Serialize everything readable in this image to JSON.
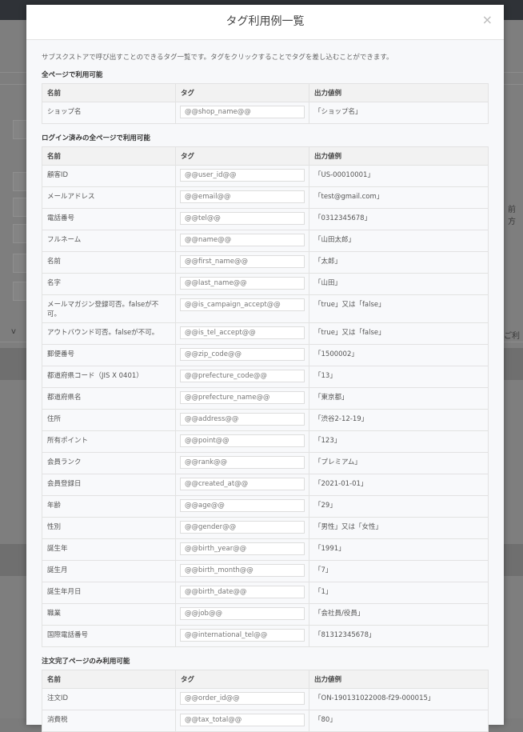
{
  "background": {
    "fragments": [
      "前方",
      "ご利",
      "v"
    ]
  },
  "modal": {
    "title": "タグ利用例一覧",
    "close_label": "×",
    "description": "サブスクストアで呼び出すことのできるタグ一覧です。タグをクリックすることでタグを差し込むことができます。",
    "columns": [
      "名前",
      "タグ",
      "出力値例"
    ],
    "sections": [
      {
        "title": "全ページで利用可能",
        "rows": [
          {
            "name": "ショップ名",
            "tag": "@@shop_name@@",
            "example": "「ショップ名」"
          }
        ]
      },
      {
        "title": "ログイン済みの全ページで利用可能",
        "rows": [
          {
            "name": "顧客ID",
            "tag": "@@user_id@@",
            "example": "「US-00010001」"
          },
          {
            "name": "メールアドレス",
            "tag": "@@email@@",
            "example": "「test@gmail.com」"
          },
          {
            "name": "電話番号",
            "tag": "@@tel@@",
            "example": "「0312345678」"
          },
          {
            "name": "フルネーム",
            "tag": "@@name@@",
            "example": "「山田太郎」"
          },
          {
            "name": "名前",
            "tag": "@@first_name@@",
            "example": "「太郎」"
          },
          {
            "name": "名字",
            "tag": "@@last_name@@",
            "example": "「山田」"
          },
          {
            "name": "メールマガジン登録可否。falseが不可。",
            "tag": "@@is_campaign_accept@@",
            "example": "「true」又は「false」"
          },
          {
            "name": "アウトバウンド可否。falseが不可。",
            "tag": "@@is_tel_accept@@",
            "example": "「true」又は「false」"
          },
          {
            "name": "郵便番号",
            "tag": "@@zip_code@@",
            "example": "「1500002」"
          },
          {
            "name": "都道府県コード（JIS X 0401）",
            "tag": "@@prefecture_code@@",
            "example": "「13」"
          },
          {
            "name": "都道府県名",
            "tag": "@@prefecture_name@@",
            "example": "「東京都」"
          },
          {
            "name": "住所",
            "tag": "@@address@@",
            "example": "「渋谷2-12-19」"
          },
          {
            "name": "所有ポイント",
            "tag": "@@point@@",
            "example": "「123」"
          },
          {
            "name": "会員ランク",
            "tag": "@@rank@@",
            "example": "「プレミアム」"
          },
          {
            "name": "会員登録日",
            "tag": "@@created_at@@",
            "example": "「2021-01-01」"
          },
          {
            "name": "年齢",
            "tag": "@@age@@",
            "example": "「29」"
          },
          {
            "name": "性別",
            "tag": "@@gender@@",
            "example": "「男性」又は「女性」"
          },
          {
            "name": "誕生年",
            "tag": "@@birth_year@@",
            "example": "「1991」"
          },
          {
            "name": "誕生月",
            "tag": "@@birth_month@@",
            "example": "「7」"
          },
          {
            "name": "誕生年月日",
            "tag": "@@birth_date@@",
            "example": "「1」"
          },
          {
            "name": "職業",
            "tag": "@@job@@",
            "example": "「会社員/役員」"
          },
          {
            "name": "国際電話番号",
            "tag": "@@international_tel@@",
            "example": "「81312345678」"
          }
        ]
      },
      {
        "title": "注文完了ページのみ利用可能",
        "rows": [
          {
            "name": "注文ID",
            "tag": "@@order_id@@",
            "example": "「ON-190131022008-f29-000015」"
          },
          {
            "name": "消費税",
            "tag": "@@tax_total@@",
            "example": "「80」"
          }
        ]
      }
    ]
  }
}
